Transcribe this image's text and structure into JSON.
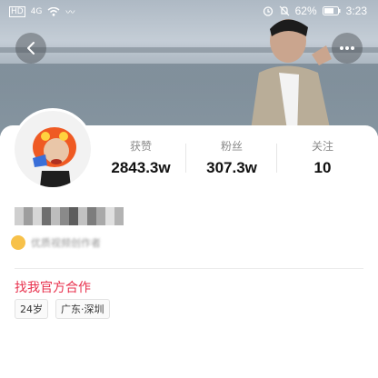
{
  "status_bar": {
    "network": "HD",
    "signal": "4G",
    "battery_percent": "62%",
    "time": "3:23"
  },
  "stats": [
    {
      "label": "获赞",
      "value": "2843.3w"
    },
    {
      "label": "粉丝",
      "value": "307.3w"
    },
    {
      "label": "关注",
      "value": "10"
    }
  ],
  "profile": {
    "creator_badge": "优质视频创作者",
    "cooperate_link": "找我官方合作",
    "tags": [
      "24岁",
      "广东·深圳"
    ]
  },
  "icons": {
    "back": "back-arrow-icon",
    "more": "more-icon"
  },
  "colors": {
    "accent": "#e8314d",
    "badge": "#f7c14a"
  }
}
